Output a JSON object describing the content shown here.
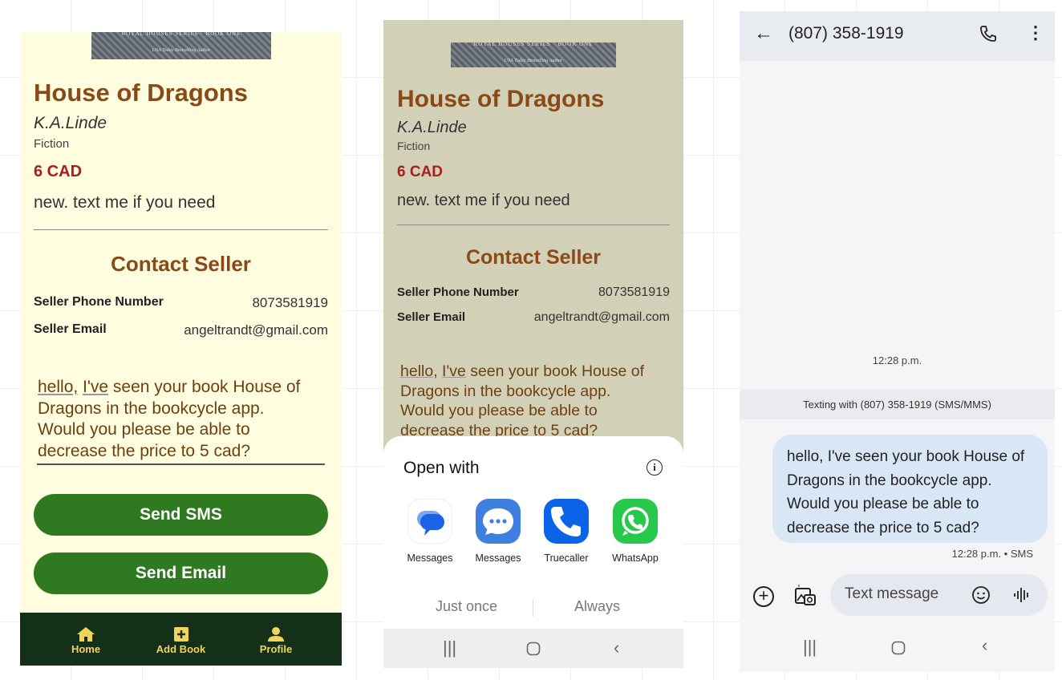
{
  "book": {
    "cover_series": "ROYAL HOUSES SERIES · BOOK ONE",
    "cover_tagline": "USA Today Bestselling Author",
    "title": "House of Dragons",
    "author": "K.A.Linde",
    "genre": "Fiction",
    "price": "6 CAD",
    "description": "new. text me if you need"
  },
  "contact": {
    "heading": "Contact Seller",
    "phone_label": "Seller Phone Number",
    "phone_value": "8073581919",
    "email_label": "Seller Email",
    "email_value": "angeltrandt@gmail.com",
    "message_first_word": "hello,",
    "message_second_word": "I've",
    "message_rest_line1": " seen your book House of",
    "message_lines": "Dragons in the bookcycle app.\nWould you please be able to\ndecrease the price to 5 cad?",
    "send_sms": "Send SMS",
    "send_email": "Send Email"
  },
  "bottom_nav": {
    "home": "Home",
    "add_book": "Add Book",
    "profile": "Profile"
  },
  "open_with": {
    "title": "Open with",
    "apps": [
      {
        "label": "Messages",
        "icon": "google-messages-icon"
      },
      {
        "label": "Messages",
        "icon": "samsung-messages-icon"
      },
      {
        "label": "Truecaller",
        "icon": "truecaller-icon"
      },
      {
        "label": "WhatsApp",
        "icon": "whatsapp-icon"
      }
    ],
    "just_once": "Just once",
    "always": "Always"
  },
  "sms_app": {
    "contact_title": "(807) 358-1919",
    "timestamp_center": "12:28 p.m.",
    "texting_with": "Texting with (807) 358-1919 (SMS/MMS)",
    "bubble_text": "hello, I've seen your book House of\nDragons in the bookcycle app.\nWould you please be able to\ndecrease the price to 5 cad?",
    "bubble_meta": "12:28 p.m. • SMS",
    "compose_placeholder": "Text message"
  },
  "colors": {
    "panel1_bg": "#fefde0",
    "panel2_bg": "#d2d1b8",
    "title_brown": "#8a4a17",
    "price_red": "#a81e1e",
    "button_green": "#2f7a21",
    "navbar_dark": "#143018",
    "nav_gold": "#f2d35b",
    "bubble_blue": "#d8e6f6"
  }
}
